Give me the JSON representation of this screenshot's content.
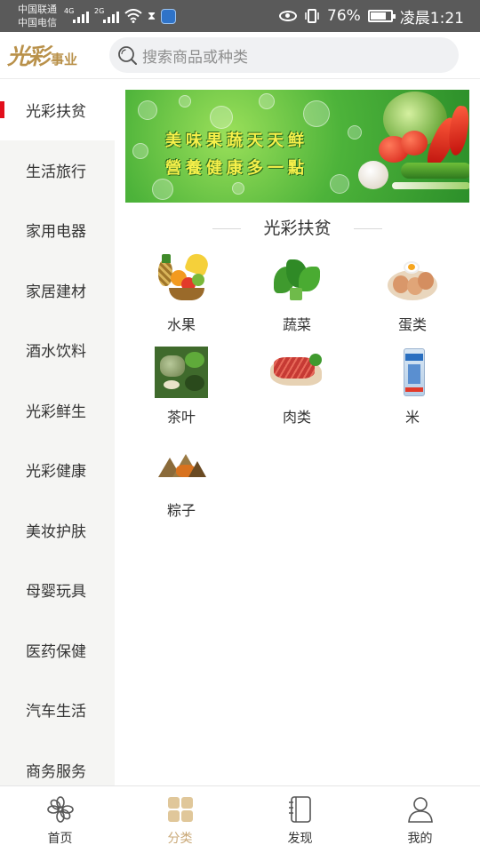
{
  "status_bar": {
    "carrier1": "中国联通",
    "carrier2": "中国电信",
    "sig1_tag": "4G",
    "sig2_tag": "2G",
    "battery": "76%",
    "battery_level": 0.76,
    "time": "凌晨1:21"
  },
  "header": {
    "logo_big": "光彩",
    "logo_small": "事业",
    "search_placeholder": "搜索商品或种类"
  },
  "sidebar": {
    "items": [
      {
        "label": "光彩扶贫",
        "active": true
      },
      {
        "label": "生活旅行"
      },
      {
        "label": "家用电器"
      },
      {
        "label": "家居建材"
      },
      {
        "label": "酒水饮料"
      },
      {
        "label": "光彩鲜生"
      },
      {
        "label": "光彩健康"
      },
      {
        "label": "美妆护肤"
      },
      {
        "label": "母婴玩具"
      },
      {
        "label": "医药保健"
      },
      {
        "label": "汽车生活"
      },
      {
        "label": "商务服务"
      }
    ]
  },
  "banner": {
    "line1": "美味果蔬天天鲜",
    "line2": "營養健康多一點"
  },
  "section": {
    "title": "光彩扶贫",
    "categories": [
      {
        "label": "水果",
        "icon": "fruit-basket-icon"
      },
      {
        "label": "蔬菜",
        "icon": "vegetable-icon"
      },
      {
        "label": "蛋类",
        "icon": "eggs-icon"
      },
      {
        "label": "茶叶",
        "icon": "tea-icon"
      },
      {
        "label": "肉类",
        "icon": "meat-icon"
      },
      {
        "label": "米",
        "icon": "rice-bag-icon"
      },
      {
        "label": "粽子",
        "icon": "zongzi-icon"
      }
    ]
  },
  "bottom_nav": {
    "items": [
      {
        "label": "首页",
        "icon": "home-flower-icon"
      },
      {
        "label": "分类",
        "icon": "category-grid-icon",
        "active": true
      },
      {
        "label": "发现",
        "icon": "discover-notebook-icon"
      },
      {
        "label": "我的",
        "icon": "profile-person-icon"
      }
    ],
    "active_color": "#c9a877"
  },
  "colors": {
    "accent_red": "#e20e1b",
    "brand_gold": "#b9914a"
  }
}
